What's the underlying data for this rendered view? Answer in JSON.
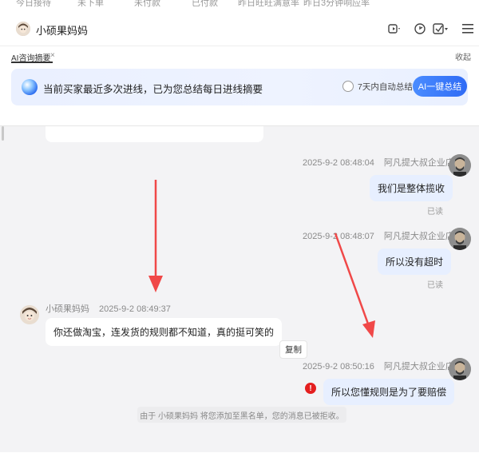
{
  "top_tabs": [
    "今日接待",
    "未下单",
    "未付款",
    "已付款",
    "昨日旺旺满意率",
    "昨日3分钟响应率"
  ],
  "header": {
    "contact_name": "小硕果妈妈",
    "icons": [
      "video-icon",
      "refresh-icon",
      "task-icon",
      "menu-icon"
    ]
  },
  "ai_panel": {
    "tab_label": "AI咨询摘要",
    "close_glyph": "×",
    "collapse_label": "收起",
    "banner_text": "当前买家最近多次进线，已为您总结每日进线摘要",
    "auto_summary_label": "7天内自动总结",
    "summary_button": "AI一键总结"
  },
  "messages": [
    {
      "side": "right",
      "time": "2025-9-2 08:48:04",
      "sender": "阿凡提大叔企业店",
      "text": "我们是整体揽收",
      "status": "已读"
    },
    {
      "side": "right",
      "time": "2025-9-2 08:48:07",
      "sender": "阿凡提大叔企业店",
      "text": "所以没有超时",
      "status": "已读"
    },
    {
      "side": "left",
      "time": "2025-9-2 08:49:37",
      "sender": "小硕果妈妈",
      "text": "你还做淘宝，连发货的规则都不知道，真的挺可笑的",
      "action": "复制"
    },
    {
      "side": "right",
      "time": "2025-9-2 08:50:16",
      "sender": "阿凡提大叔企业店",
      "text": "所以您懂规则是为了要赔偿",
      "status": "error"
    }
  ],
  "system_note": "由于 小硕果妈妈 将您添加至黑名单，您的消息已被拒收。",
  "colors": {
    "accent_blue": "#2f6bf5",
    "bubble_right": "#e7efff",
    "error_red": "#e41f1f",
    "arrow_red": "#f04848"
  }
}
